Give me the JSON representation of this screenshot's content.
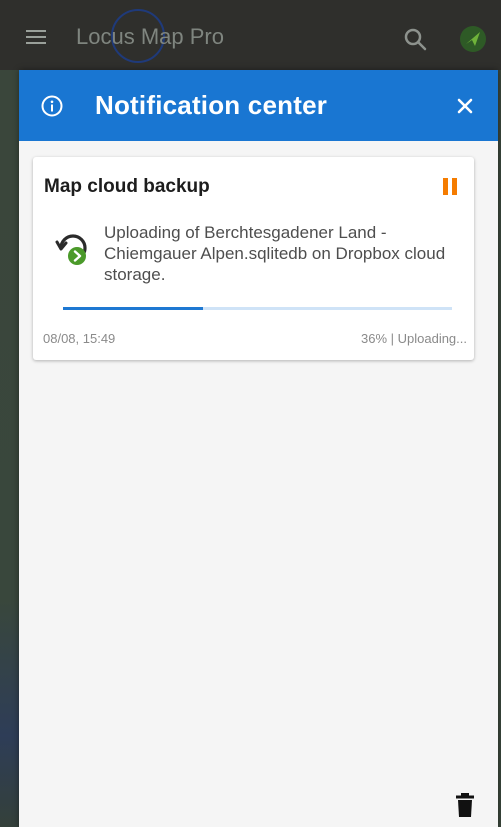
{
  "app": {
    "title": "Locus Map Pro",
    "icons": [
      "menu-icon",
      "search-icon",
      "gps-icon"
    ]
  },
  "notification_center": {
    "title": "Notification center",
    "header_color": "#1976d2",
    "icons": [
      "info-icon",
      "close-icon",
      "trash-icon"
    ]
  },
  "notifications": [
    {
      "title": "Map cloud backup",
      "message": "Uploading of Berchtesgadener Land - Chiemgauer Alpen.sqlitedb on Dropbox cloud storage.",
      "timestamp": "08/08, 15:49",
      "status": "36% | Uploading...",
      "progress_percent": 36,
      "icon": "cloud-upload-icon",
      "action_icon": "pause-icon",
      "accent_color": "#f57c00"
    }
  ]
}
